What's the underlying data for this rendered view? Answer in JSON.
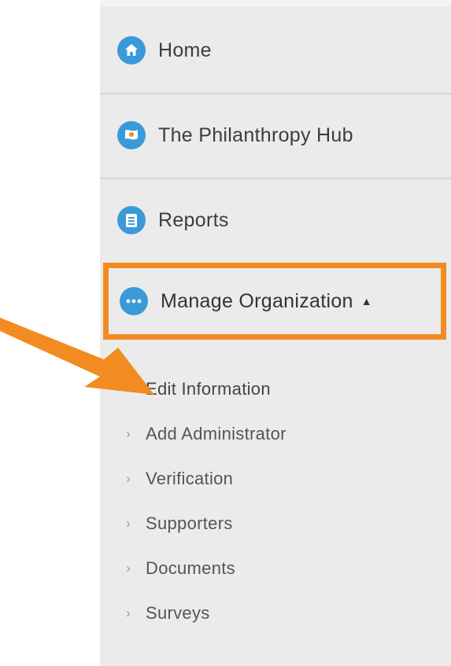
{
  "sidebar": {
    "items": [
      {
        "label": "Home",
        "icon": "home-icon"
      },
      {
        "label": "The Philanthropy Hub",
        "icon": "flag-icon"
      },
      {
        "label": "Reports",
        "icon": "clipboard-icon"
      }
    ],
    "manage": {
      "label": "Manage Organization",
      "icon": "more-dots-icon",
      "caret": "▲",
      "highlight_color": "#f28c22"
    },
    "subitems": [
      {
        "label": "Edit Information"
      },
      {
        "label": "Add Administrator"
      },
      {
        "label": "Verification"
      },
      {
        "label": "Supporters"
      },
      {
        "label": "Documents"
      },
      {
        "label": "Surveys"
      }
    ]
  },
  "colors": {
    "icon_blue": "#3a9ad9",
    "annotation_orange": "#f28c22",
    "sidebar_bg": "#ebebeb"
  }
}
